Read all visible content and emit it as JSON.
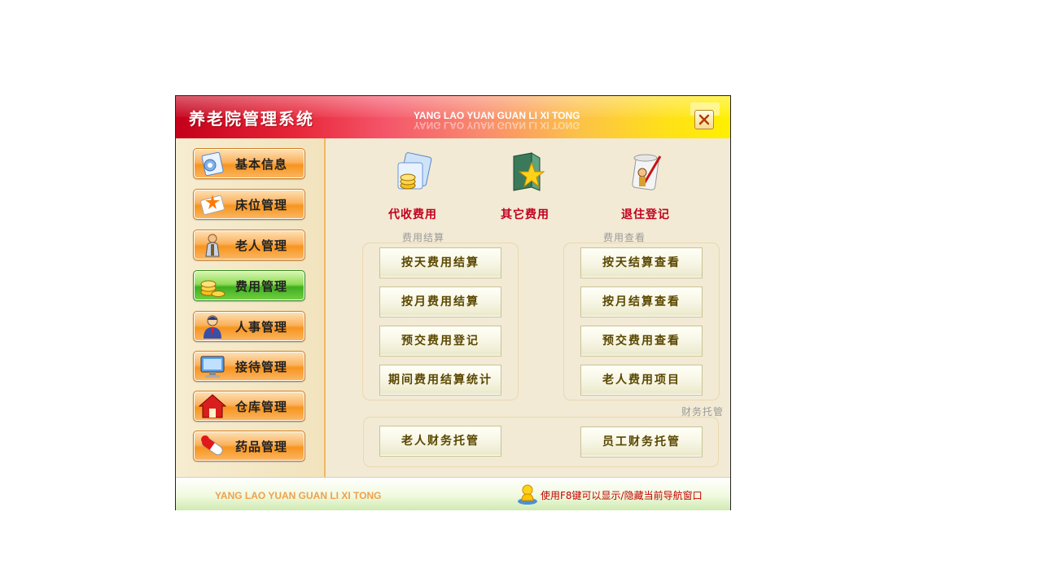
{
  "window": {
    "title": "养老院管理系统",
    "pinyin": "YANG LAO YUAN GUAN LI XI TONG"
  },
  "sidebar": {
    "items": [
      {
        "label": "基本信息",
        "icon": "document-icon",
        "active": false
      },
      {
        "label": "床位管理",
        "icon": "star-card-icon",
        "active": false
      },
      {
        "label": "老人管理",
        "icon": "person-icon",
        "active": false
      },
      {
        "label": "费用管理",
        "icon": "coins-icon",
        "active": true
      },
      {
        "label": "人事管理",
        "icon": "staff-icon",
        "active": false
      },
      {
        "label": "接待管理",
        "icon": "monitor-icon",
        "active": false
      },
      {
        "label": "仓库管理",
        "icon": "house-icon",
        "active": false
      },
      {
        "label": "药品管理",
        "icon": "pill-icon",
        "active": false
      }
    ]
  },
  "top_actions": [
    {
      "label": "代收费用",
      "icon": "coin-folder-icon"
    },
    {
      "label": "其它费用",
      "icon": "star-book-icon"
    },
    {
      "label": "退住登记",
      "icon": "scroll-pen-icon"
    }
  ],
  "groups": {
    "settlement": {
      "title": "费用结算",
      "buttons": [
        "按天费用结算",
        "按月费用结算",
        "预交费用登记",
        "期间费用结算统计"
      ]
    },
    "inquiry": {
      "title": "费用查看",
      "buttons": [
        "按天结算查看",
        "按月结算查看",
        "预交费用查看",
        "老人费用项目"
      ]
    },
    "custody": {
      "title": "财务托管",
      "buttons": [
        "老人财务托管",
        "员工财务托管"
      ]
    }
  },
  "statusbar": {
    "pinyin": "YANG LAO YUAN GUAN LI XI TONG",
    "hint": "使用F8键可以显示/隐藏当前导航窗口"
  },
  "colors": {
    "title_gradient_start": "#c4001a",
    "title_gradient_end": "#fff000",
    "active_nav": "#3fae20",
    "nav": "#f7951f",
    "action_label": "#c2001f",
    "button_text": "#5a4700",
    "hint_text": "#c40000"
  }
}
